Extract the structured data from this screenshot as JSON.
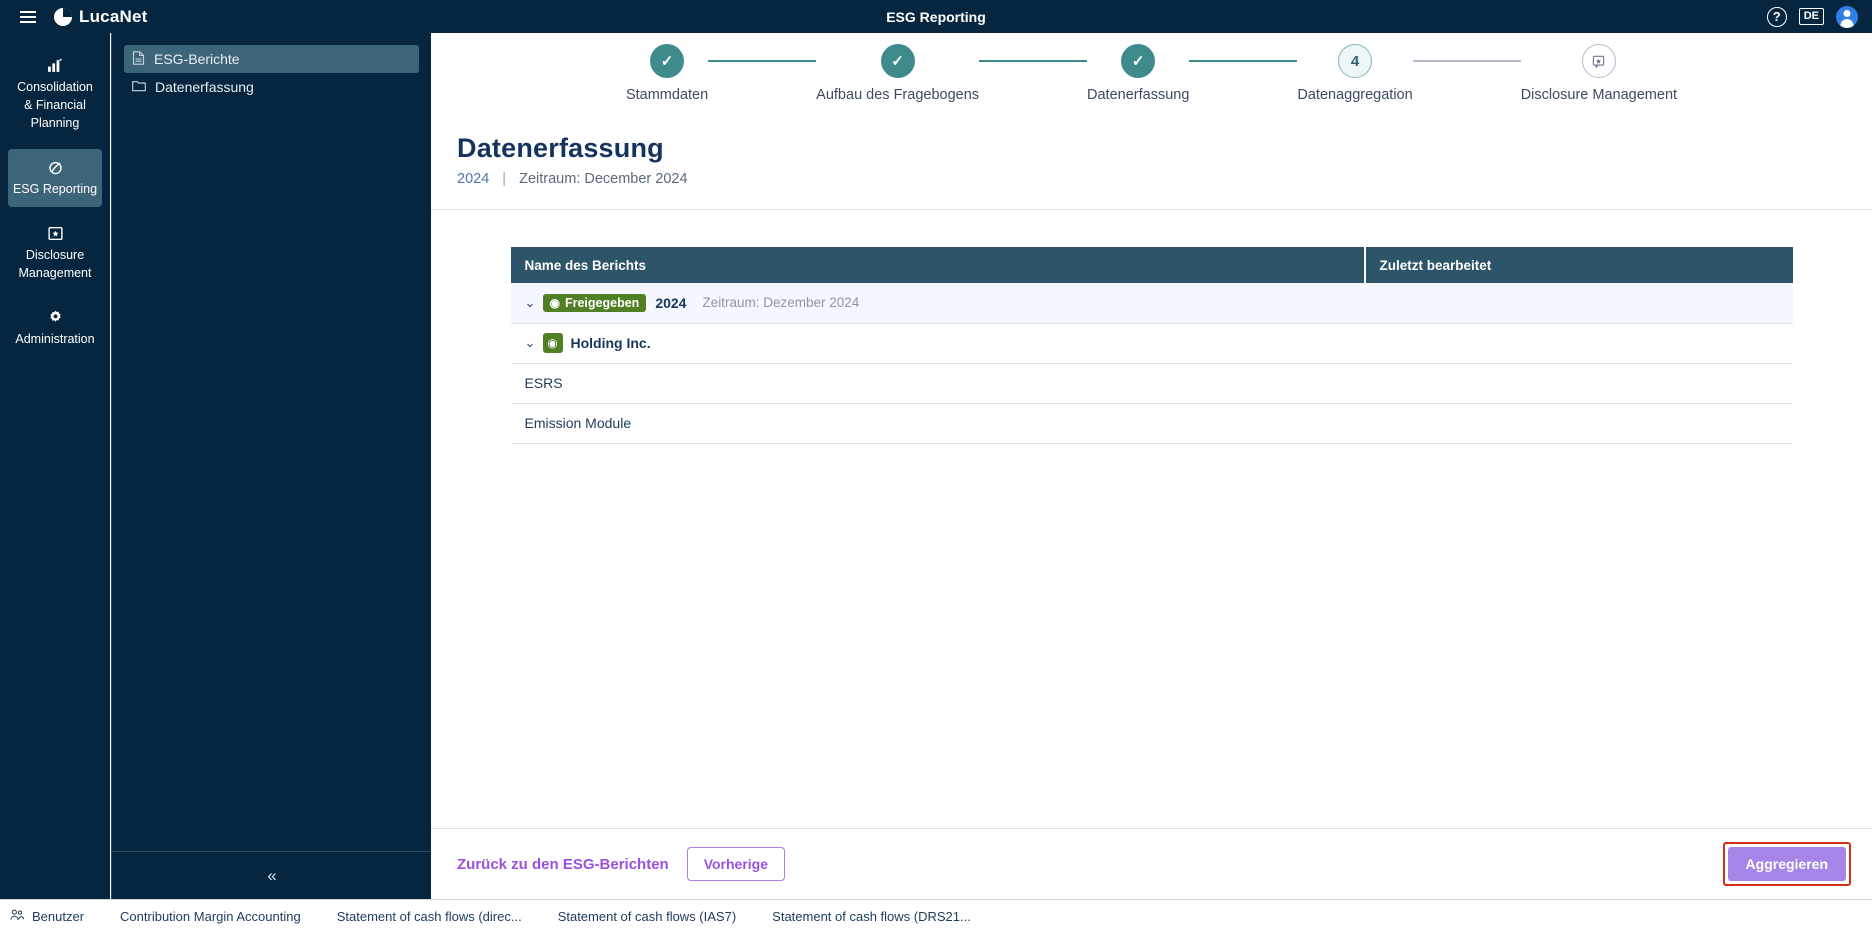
{
  "titlebar": {
    "menu_icon": "hamburger-icon",
    "brand": "LucaNet",
    "app_title": "ESG Reporting",
    "help_icon": "?",
    "language": "DE",
    "avatar_icon": "user-avatar-icon"
  },
  "rail": {
    "items": [
      {
        "glyph": "ὌA",
        "label": "Consolidation & Financial Planning",
        "name": "consolidation-financial-planning",
        "active": false
      },
      {
        "glyph": "Ⓔ",
        "label": "ESG Reporting",
        "name": "esg-reporting",
        "active": true
      },
      {
        "glyph": "⊡",
        "label": "Disclosure Management",
        "name": "disclosure-management",
        "active": false
      },
      {
        "glyph": "⚙",
        "label": "Administration",
        "name": "administration",
        "active": false
      }
    ]
  },
  "tree": {
    "items": [
      {
        "label": "ESG-Berichte",
        "icon": "document-icon",
        "selected": true
      },
      {
        "label": "Datenerfassung",
        "icon": "folder-icon",
        "selected": false
      }
    ],
    "collapse_icon": "«"
  },
  "stepper": {
    "steps": [
      {
        "label": "Stammdaten",
        "state": "done",
        "marker": "✓"
      },
      {
        "label": "Aufbau des Fragebogens",
        "state": "done",
        "marker": "✓"
      },
      {
        "label": "Datenerfassung",
        "state": "done",
        "marker": "✓"
      },
      {
        "label": "Datenaggregation",
        "state": "current",
        "marker": "4"
      },
      {
        "label": "Disclosure Management",
        "state": "todo",
        "marker": "⊡"
      }
    ]
  },
  "page": {
    "title": "Datenerfassung",
    "year": "2024",
    "separator": "|",
    "period": "Zeitraum: December 2024"
  },
  "table": {
    "columns": [
      "Name des Berichts",
      "Zuletzt bearbeitet"
    ],
    "rows": [
      {
        "level": 0,
        "chevron": "⌄",
        "badge_text": "Freigegeben",
        "badge_icon": "◉",
        "year": "2024",
        "range": "Zeitraum: Dezember 2024",
        "last_edited": ""
      },
      {
        "level": 1,
        "chevron": "⌄",
        "badge_icon": "◉",
        "entity": "Holding Inc.",
        "last_edited": ""
      },
      {
        "level": 2,
        "name": "ESRS",
        "last_edited": ""
      },
      {
        "level": 2,
        "name": "Emission Module",
        "last_edited": ""
      }
    ]
  },
  "actions": {
    "back_link": "Zurück zu den ESG-Berichten",
    "previous": "Vorherige",
    "aggregate": "Aggregieren"
  },
  "statusbar": {
    "items": [
      "Benutzer",
      "Contribution Margin Accounting",
      "Statement of cash flows (direc...",
      "Statement of cash flows (IAS7)",
      "Statement of cash flows (DRS21..."
    ]
  },
  "colors": {
    "header_navy": "#06263f",
    "step_done": "#3f8b8b",
    "table_header": "#2d5469",
    "badge_green": "#517f25",
    "primary_purple": "#a585e8",
    "highlight_red": "#d32f12"
  }
}
